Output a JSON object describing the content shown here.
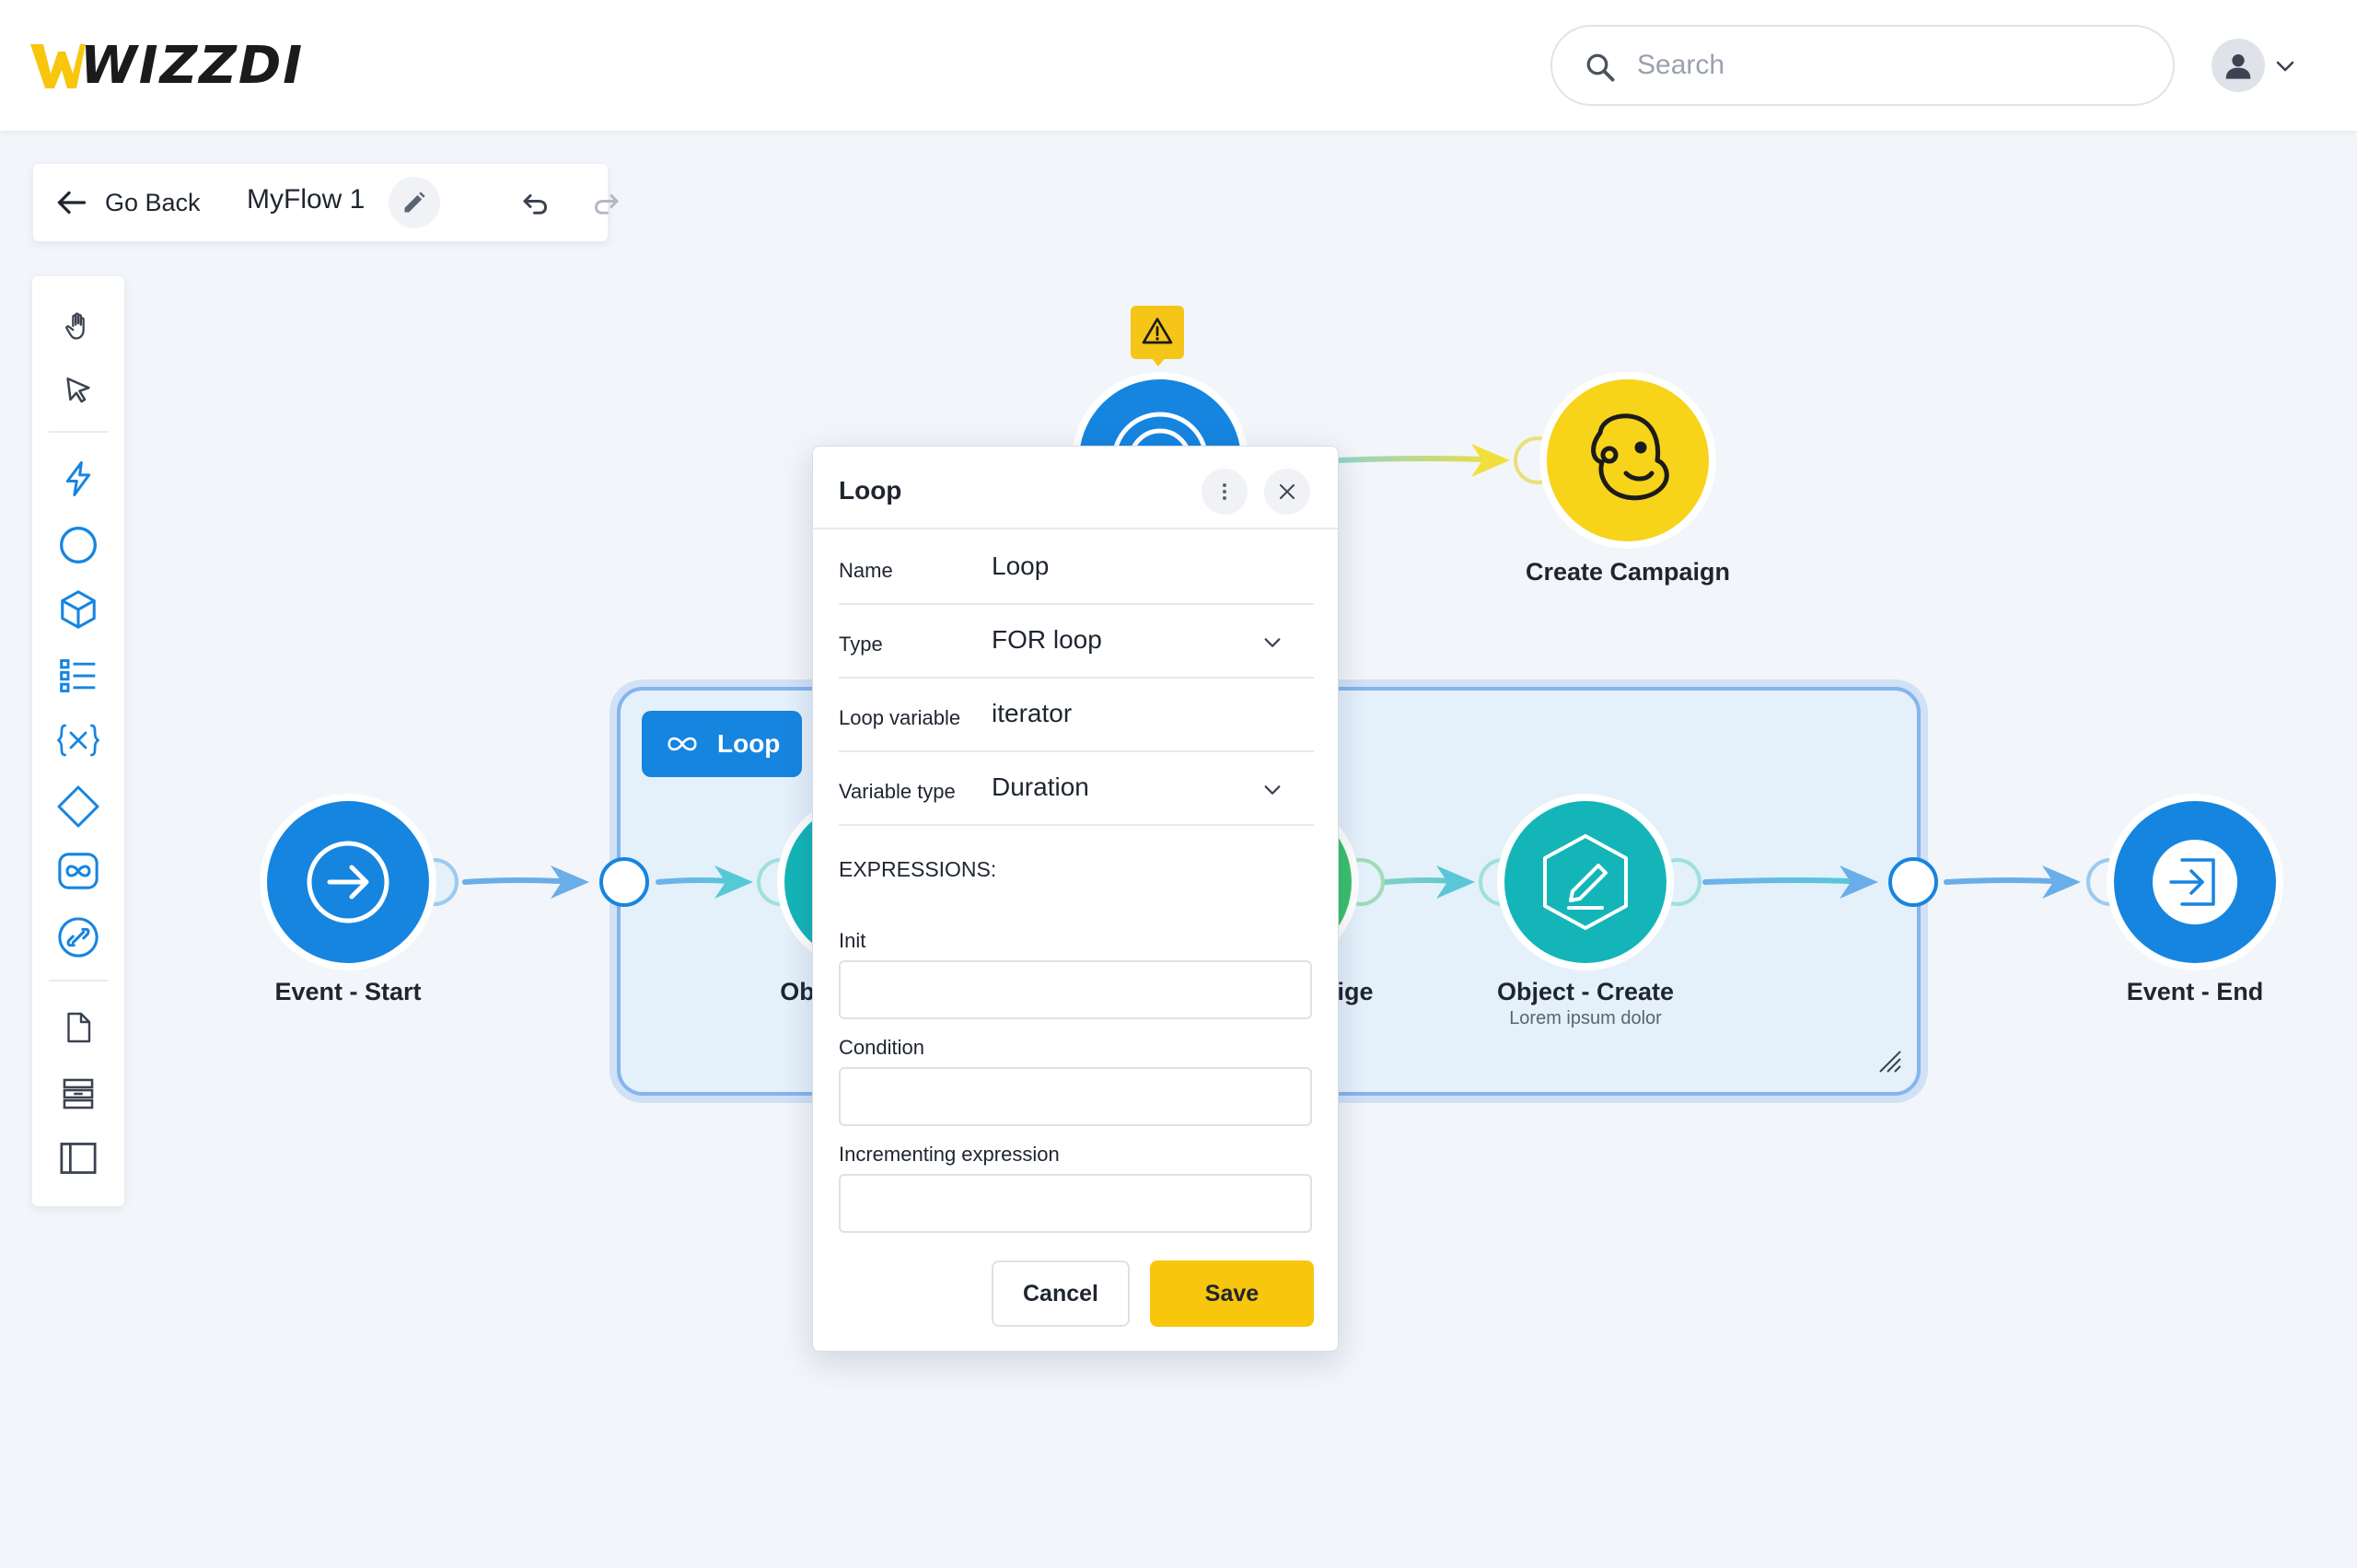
{
  "header": {
    "logo_text": "WIZZDI",
    "search_placeholder": "Search"
  },
  "toolbar": {
    "go_back_label": "Go Back",
    "flow_name": "MyFlow 1"
  },
  "palette": {
    "tools": [
      "hand-icon",
      "pointer-icon",
      "lightning-icon",
      "circle-icon",
      "cube-icon",
      "list-icon",
      "variable-icon",
      "diamond-icon",
      "loop-icon",
      "link-icon",
      "document-icon",
      "stack-icon",
      "panel-icon"
    ]
  },
  "canvas": {
    "loop_group_label": "Loop",
    "nodes": {
      "event_start": {
        "label": "Event - Start"
      },
      "partial_left": {
        "label": "Ob"
      },
      "partial_right": {
        "label": "ige"
      },
      "object_create": {
        "label": "Object - Create",
        "sublabel": "Lorem ipsum dolor"
      },
      "event_end": {
        "label": "Event - End"
      },
      "create_campaign": {
        "label": "Create Campaign"
      }
    },
    "colors": {
      "primary_blue": "#1685e0",
      "teal": "#14b5b8",
      "yellow": "#f7d31a",
      "warning": "#f5c518"
    }
  },
  "dialog": {
    "title": "Loop",
    "fields": {
      "name": {
        "label": "Name",
        "value": "Loop"
      },
      "type": {
        "label": "Type",
        "value": "FOR loop"
      },
      "loop_variable": {
        "label": "Loop variable",
        "value": "iterator"
      },
      "variable_type": {
        "label": "Variable type",
        "value": "Duration"
      }
    },
    "expressions_title": "EXPRESSIONS:",
    "init_label": "Init",
    "init_value": "",
    "condition_label": "Condition",
    "condition_value": "",
    "increment_label": "Incrementing expression",
    "increment_value": "",
    "cancel_label": "Cancel",
    "save_label": "Save"
  }
}
